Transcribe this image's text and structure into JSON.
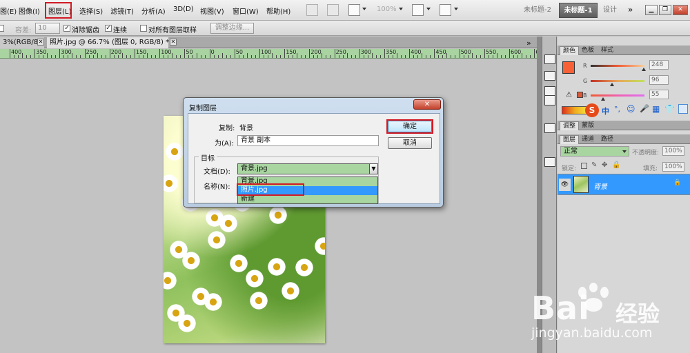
{
  "menubar": {
    "items": [
      "图(E)",
      "图像(I)",
      "图层(L)",
      "选择(S)",
      "滤镜(T)",
      "分析(A)",
      "3D(D)",
      "视图(V)",
      "窗口(W)",
      "帮助(H)"
    ],
    "zoom": "100%",
    "workspace_tabs": [
      "未标题-2",
      "未标题-1",
      "设计"
    ],
    "collapse_label": "»"
  },
  "optbar": {
    "tolerance_label": "容差:",
    "tolerance_value": "10",
    "antialias_label": "消除锯齿",
    "contiguous_label": "连续",
    "sample_all_label": "对所有图层取样",
    "refine_edge_label": "调整边缘..."
  },
  "doc_tabs": [
    {
      "label": "3%(RGB/8)"
    },
    {
      "label": "照片.jpg @ 66.7% (图层 0, RGB/8) *"
    }
  ],
  "ruler": {
    "numbers": [
      "400",
      "350",
      "300",
      "250",
      "200",
      "150",
      "100",
      "50",
      "0",
      "50",
      "100",
      "150",
      "200",
      "250",
      "300",
      "350",
      "400",
      "450",
      "500",
      "550",
      "600",
      "650"
    ]
  },
  "color_panel": {
    "tabs": [
      "颜色",
      "色板",
      "样式"
    ],
    "r_label": "R",
    "g_label": "G",
    "b_label": "B",
    "r": "248",
    "g": "96",
    "b": "55",
    "foreground": "#f86037",
    "ime_icons": [
      "S",
      "中",
      "°,",
      "☺",
      "🎤",
      "▦",
      "👕"
    ]
  },
  "adjust_panel": {
    "tabs": [
      "调整",
      "蒙版"
    ]
  },
  "layers_panel": {
    "tabs": [
      "图层",
      "通道",
      "路径"
    ],
    "blend_mode": "正常",
    "opacity_label": "不透明度:",
    "opacity": "100%",
    "lock_label": "锁定:",
    "fill_label": "填充:",
    "fill": "100%",
    "layer_name": "背景"
  },
  "dialog": {
    "title": "复制图层",
    "close_label": "✕",
    "copy_label": "复制:",
    "copy_value": "背景",
    "as_label": "为(A):",
    "as_value": "背景 副本",
    "ok_label": "确定",
    "cancel_label": "取消",
    "target_label": "目标",
    "document_label": "文档(D):",
    "document_value": "背景.jpg",
    "name_label": "名称(N):",
    "document_options": [
      "背景.jpg",
      "照片.jpg",
      "新建"
    ],
    "highlighted_option": 1
  },
  "watermark": {
    "brand": "Bai",
    "brand_suffix": "经验",
    "url": "jingyan.baidu.com"
  }
}
